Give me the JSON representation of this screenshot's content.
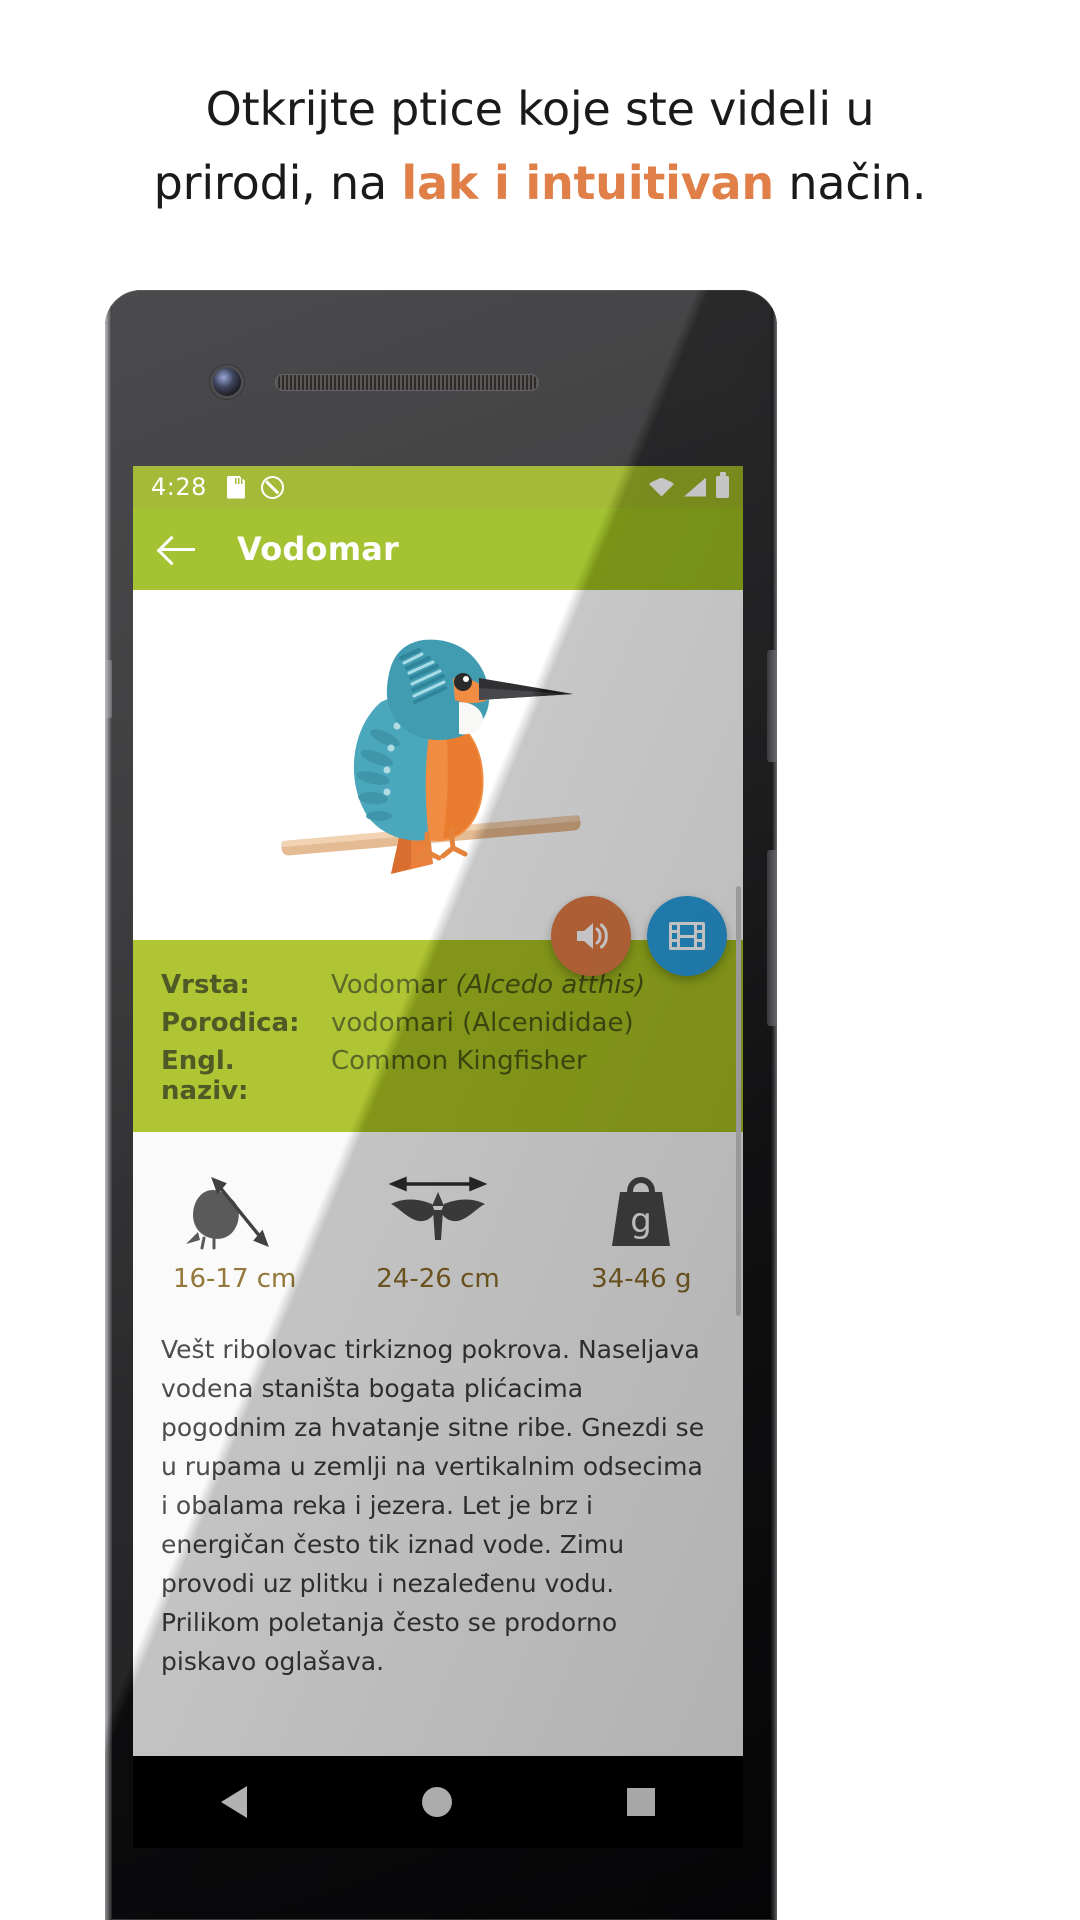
{
  "headline": {
    "line1": "Otkrijte ptice koje ste videli u",
    "line2_pre": "prirodi, na ",
    "line2_accent": "lak i intuitivan",
    "line2_post": " način.",
    "accent_color": "#e08048"
  },
  "phone": {
    "statusbar": {
      "time": "4:28",
      "icons_left": [
        "sd-card-icon",
        "do-not-disturb-icon"
      ],
      "icons_right": [
        "wifi-icon",
        "cellular-signal-icon",
        "battery-icon"
      ],
      "background_color": "#9cb326"
    },
    "appbar": {
      "back_label": "back-arrow-icon",
      "title": "Vodomar",
      "background_color": "#9cbc1e"
    },
    "bird_image": {
      "name": "common-kingfisher-illustration",
      "alt": "Vodomar"
    },
    "actions": [
      {
        "name": "play-sound-button",
        "icon": "speaker-icon",
        "color": "#e27b45"
      },
      {
        "name": "play-video-button",
        "icon": "film-icon",
        "color": "#29a0e0"
      }
    ],
    "info": {
      "background_color": "#a8c020",
      "rows": [
        {
          "label": "Vrsta:",
          "value": "Vodomar ",
          "scientific": "(Alcedo atthis)"
        },
        {
          "label": "Porodica:",
          "value": "vodomari (Alcenididae)",
          "scientific": ""
        },
        {
          "label": "Engl. naziv:",
          "value": "Common Kingfisher",
          "scientific": ""
        }
      ]
    },
    "stats": [
      {
        "icon": "bird-length-icon",
        "value": "16-17 cm"
      },
      {
        "icon": "bird-wingspan-icon",
        "value": "24-26 cm"
      },
      {
        "icon": "bird-weight-icon",
        "value": "34-46 g"
      }
    ],
    "description": "Vešt ribolovac tirkiznog pokrova. Naseljava vodena staništa bogata plićacima pogodnim za hvatanje sitne ribe. Gnezdi se u rupama u zemlji na vertikalnim odsecima i obalama reka i jezera. Let je brz i energičan često tik iznad vode. Zimu provodi uz plitku i nezaleđenu vodu. Prilikom poletanja često se prodorno piskavo oglašava.",
    "navbar": {
      "items": [
        "nav-back-icon",
        "nav-home-icon",
        "nav-recents-icon"
      ]
    }
  }
}
